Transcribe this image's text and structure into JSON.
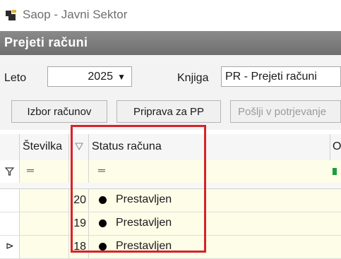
{
  "window": {
    "title": "Saop  - Javni Sektor"
  },
  "header": {
    "title": "Prejeti računi"
  },
  "filters": {
    "leto_label": "Leto",
    "year_value": "2025",
    "knjiga_label": "Knjiga",
    "knjiga_value": "PR - Prejeti računi"
  },
  "toolbar": {
    "btn_izbor": "Izbor računov",
    "btn_priprava": "Priprava za PP",
    "btn_poslji": "Pošlji v potrjevanje"
  },
  "grid": {
    "columns": [
      "Številka",
      "Status računa",
      "O"
    ],
    "filter_symbol": "═",
    "rows": [
      {
        "num": "20",
        "status": "Prestavljen"
      },
      {
        "num": "19",
        "status": "Prestavljen"
      },
      {
        "num": "18",
        "status": "Prestavljen"
      }
    ]
  },
  "colors": {
    "highlight": "#d6222b",
    "header_bg": "#7c7c7c",
    "row_bg": "#fdfde8"
  }
}
